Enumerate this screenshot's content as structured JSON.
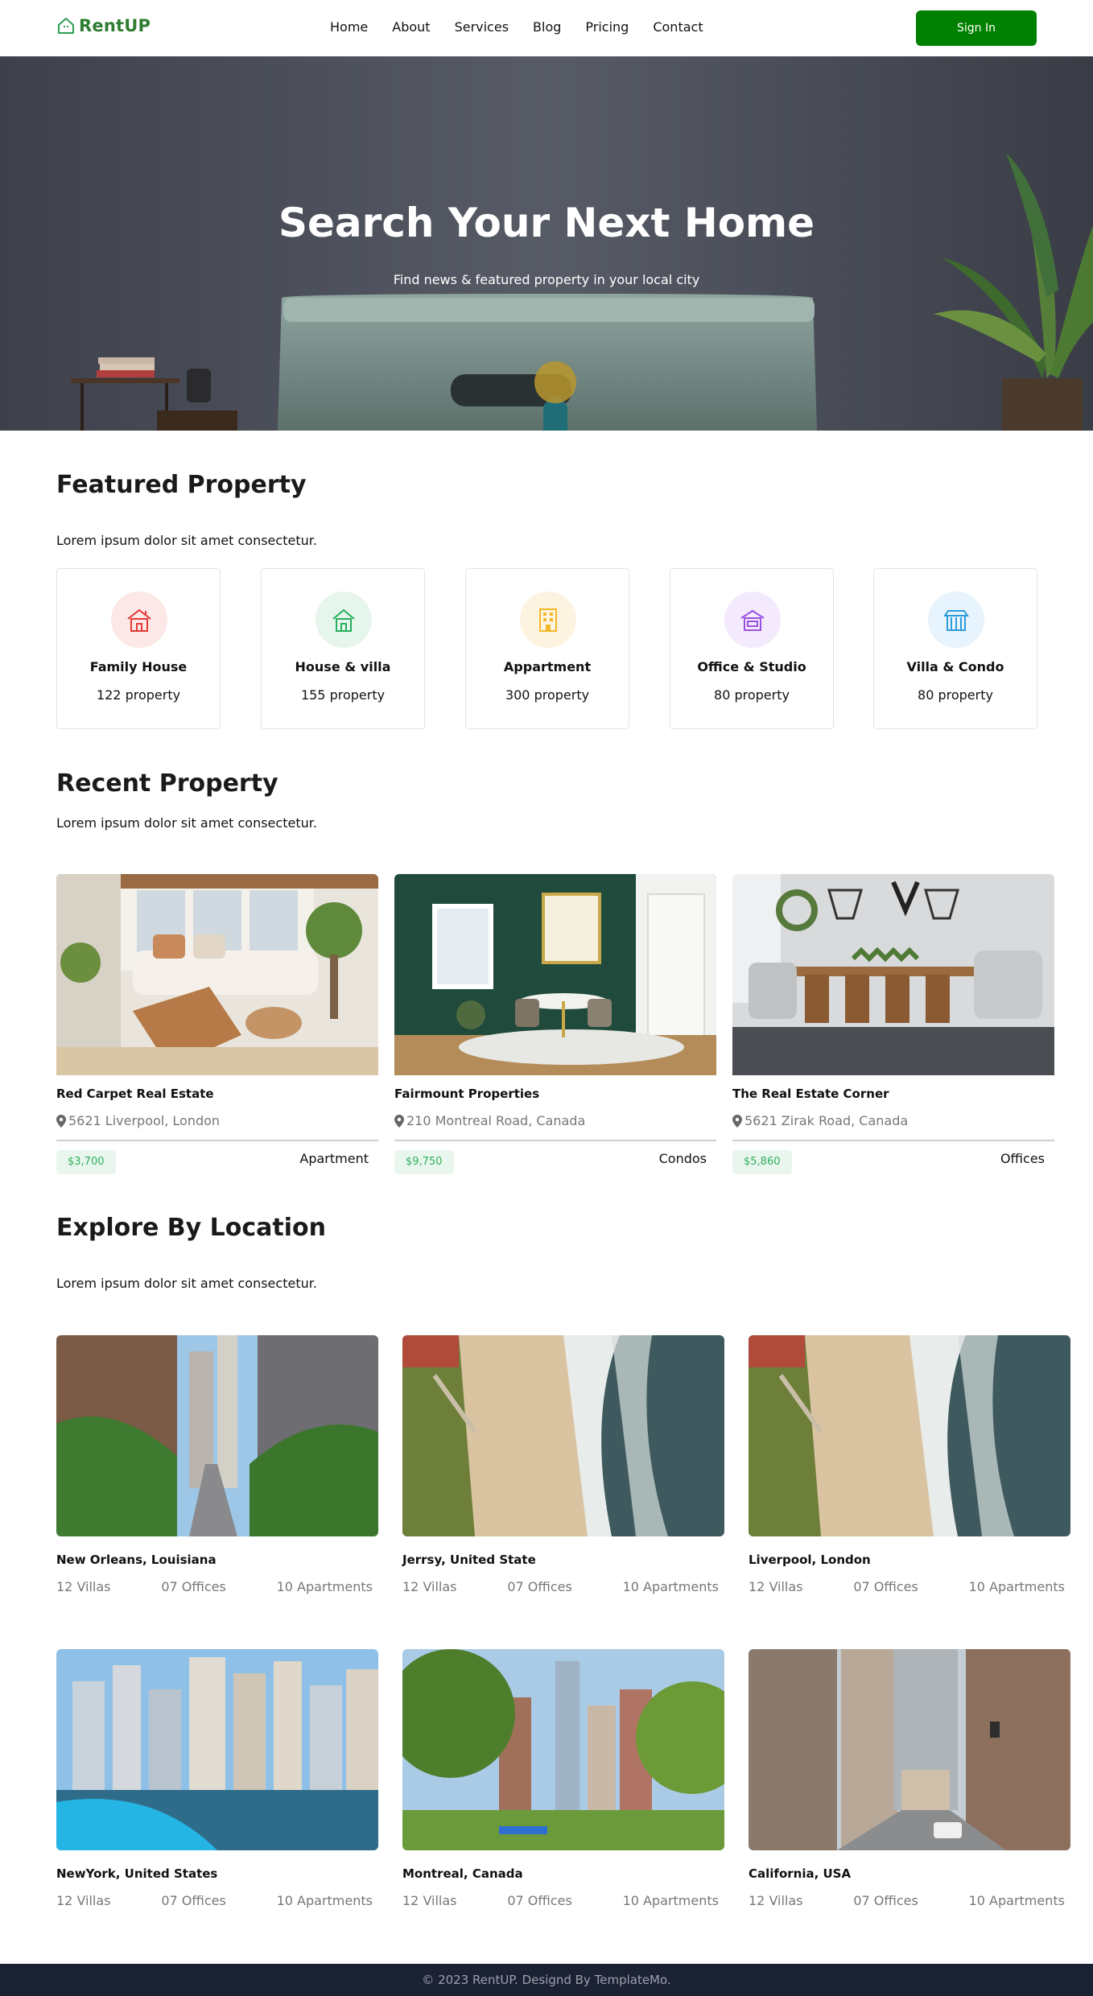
{
  "header": {
    "logo": "RentUP",
    "nav": [
      "Home",
      "About",
      "Services",
      "Blog",
      "Pricing",
      "Contact"
    ],
    "signin_label": "Sign In",
    "signin_color": "#008000"
  },
  "hero": {
    "title": "Search Your Next Home",
    "subtitle": "Find news & featured property in your local city"
  },
  "featured": {
    "heading": "Featured Property",
    "lead": "Lorem ipsum dolor sit amet consectetur.",
    "items": [
      {
        "title": "Family House",
        "count": "122 property",
        "icon": "house-icon",
        "color": "#e53935",
        "bg": "#fde8e8"
      },
      {
        "title": "House & villa",
        "count": "155 property",
        "icon": "villa-icon",
        "color": "#27ae60",
        "bg": "#e6f6ec"
      },
      {
        "title": "Appartment",
        "count": "300 property",
        "icon": "apartment-icon",
        "color": "#f2b826",
        "bg": "#fdf3e1"
      },
      {
        "title": "Office & Studio",
        "count": "80 property",
        "icon": "office-icon",
        "color": "#9b51e0",
        "bg": "#f4eafd"
      },
      {
        "title": "Villa & Condo",
        "count": "80 property",
        "icon": "condo-icon",
        "color": "#2d9cdb",
        "bg": "#e7f4fd"
      }
    ]
  },
  "recent": {
    "heading": "Recent Property",
    "lead": "Lorem ipsum dolor sit amet consectetur.",
    "items": [
      {
        "name": "Red Carpet Real Estate",
        "address": "5621 Liverpool, London",
        "price": "$3,700",
        "type": "Apartment"
      },
      {
        "name": "Fairmount Properties",
        "address": "210 Montreal Road, Canada",
        "price": "$9,750",
        "type": "Condos"
      },
      {
        "name": "The Real Estate Corner",
        "address": "5621 Zirak Road, Canada",
        "price": "$5,860",
        "type": "Offices"
      }
    ]
  },
  "locations": {
    "heading": "Explore By Location",
    "lead": "Lorem ipsum dolor sit amet consectetur.",
    "items": [
      {
        "name": "New Orleans, Louisiana",
        "villas": "12 Villas",
        "offices": "07 Offices",
        "apartments": "10 Apartments"
      },
      {
        "name": "Jerrsy, United State",
        "villas": "12 Villas",
        "offices": "07 Offices",
        "apartments": "10 Apartments"
      },
      {
        "name": "Liverpool, London",
        "villas": "12 Villas",
        "offices": "07 Offices",
        "apartments": "10 Apartments"
      },
      {
        "name": "NewYork, United States",
        "villas": "12 Villas",
        "offices": "07 Offices",
        "apartments": "10 Apartments"
      },
      {
        "name": "Montreal, Canada",
        "villas": "12 Villas",
        "offices": "07 Offices",
        "apartments": "10 Apartments"
      },
      {
        "name": "California, USA",
        "villas": "12 Villas",
        "offices": "07 Offices",
        "apartments": "10 Apartments"
      }
    ]
  },
  "footer": {
    "copyright": "© 2023 RentUP. Designd By TemplateMo."
  }
}
